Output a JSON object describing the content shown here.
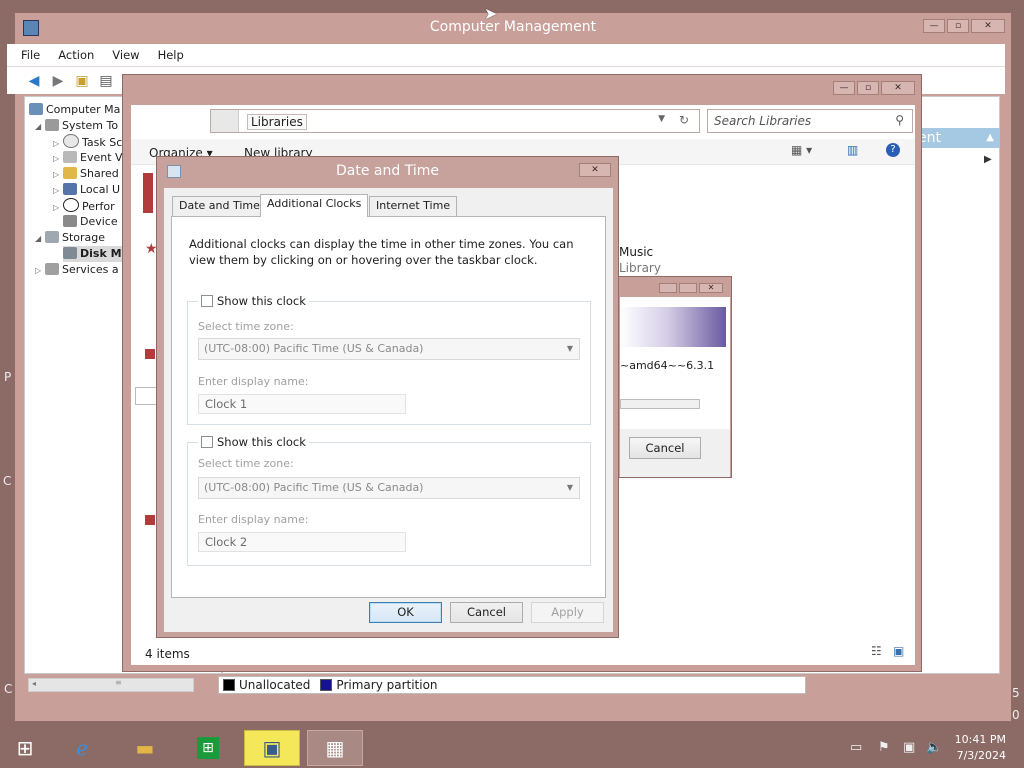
{
  "computer_management": {
    "title": "Computer Management",
    "menu": [
      "File",
      "Action",
      "View",
      "Help"
    ],
    "tree": [
      {
        "label": "Computer Ma",
        "level": 0,
        "arrow": ""
      },
      {
        "label": "System To",
        "level": 1,
        "arrow": "◢"
      },
      {
        "label": "Task Sc",
        "level": 2,
        "arrow": "▷"
      },
      {
        "label": "Event V",
        "level": 2,
        "arrow": "▷"
      },
      {
        "label": "Shared",
        "level": 2,
        "arrow": "▷"
      },
      {
        "label": "Local U",
        "level": 2,
        "arrow": "▷"
      },
      {
        "label": "Perfor",
        "level": 2,
        "arrow": "▷"
      },
      {
        "label": "Device",
        "level": 2,
        "arrow": ""
      },
      {
        "label": "Storage",
        "level": 1,
        "arrow": "◢"
      },
      {
        "label": "Disk M",
        "level": 2,
        "arrow": ""
      },
      {
        "label": "Services a",
        "level": 1,
        "arrow": "▷"
      }
    ],
    "actions_header": "ent",
    "legend": {
      "unallocated": "Unallocated",
      "primary": "Primary partition"
    }
  },
  "libraries": {
    "address": "Libraries",
    "search_placeholder": "Search Libraries",
    "organize": "Organize ▾",
    "new_library": "New library",
    "music": "Music",
    "library_sub": "Library",
    "status": "4 items"
  },
  "progress_dialog": {
    "text": "~amd64~~6.3.1",
    "cancel": "Cancel"
  },
  "date_time": {
    "title": "Date and Time",
    "tabs": [
      "Date and Time",
      "Additional Clocks",
      "Internet Time"
    ],
    "intro": "Additional clocks can display the time in other time zones. You can view them by clicking on or hovering over the taskbar clock.",
    "clock1": {
      "show_label": "Show this clock",
      "tz_label": "Select time zone:",
      "tz_value": "(UTC-08:00) Pacific Time (US & Canada)",
      "name_label": "Enter display name:",
      "name_value": "Clock 1",
      "checked": false
    },
    "clock2": {
      "show_label": "Show this clock",
      "tz_label": "Select time zone:",
      "tz_value": "(UTC-08:00) Pacific Time (US & Canada)",
      "name_label": "Enter display name:",
      "name_value": "Clock 2",
      "checked": false
    },
    "buttons": {
      "ok": "OK",
      "cancel": "Cancel",
      "apply": "Apply"
    }
  },
  "taskbar": {
    "time": "10:41 PM",
    "date": "7/3/2024"
  },
  "desktop_edge": {
    "left_a": "P",
    "left_b": "C",
    "left_c": "C",
    "right_a": "5",
    "right_b": "0"
  }
}
